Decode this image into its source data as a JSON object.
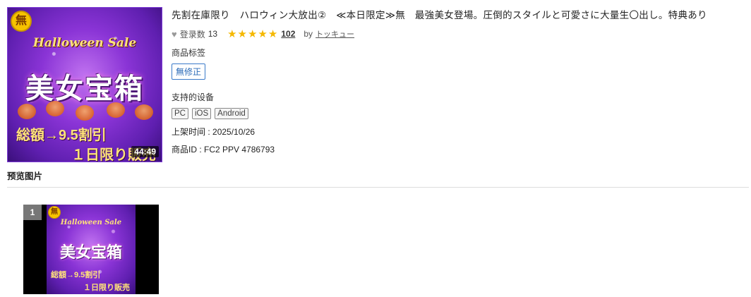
{
  "thumbnail": {
    "badge": "無",
    "sale_text": "Halloween Sale",
    "title_big": "美女宝箱",
    "line1": "総額→9.5割引",
    "line2": "１日限り販売",
    "duration": "44:49"
  },
  "product": {
    "title": "先割在庫限り　ハロウィン大放出②　≪本日限定≫無　最強美女登場。圧倒的スタイルと可愛さに大量生〇出し。特典あり",
    "heart_icon": "heart-icon",
    "registered_label": "登录数",
    "registered_count": "13",
    "stars": "★★★★★",
    "rating_count": "102",
    "by_label": "by",
    "author": "トッキュー",
    "tags_label": "商品标签",
    "tags": [
      "無修正"
    ],
    "devices_label": "支持的设备",
    "devices": [
      "PC",
      "iOS",
      "Android"
    ],
    "release_label": "上架时间 :",
    "release_date": "2025/10/26",
    "product_id_label": "商品ID :",
    "product_id": "FC2 PPV 4786793"
  },
  "preview": {
    "heading": "预览图片",
    "items": [
      {
        "number": "1",
        "badge": "無",
        "sale_text": "Halloween Sale",
        "title_big": "美女宝箱",
        "line1": "総額→9.5割引",
        "line2": "１日限り販売"
      }
    ]
  },
  "colors": {
    "star": "#f5b800",
    "tag_border": "#3a7ac9",
    "thumb_purple": "#8a34d6"
  }
}
